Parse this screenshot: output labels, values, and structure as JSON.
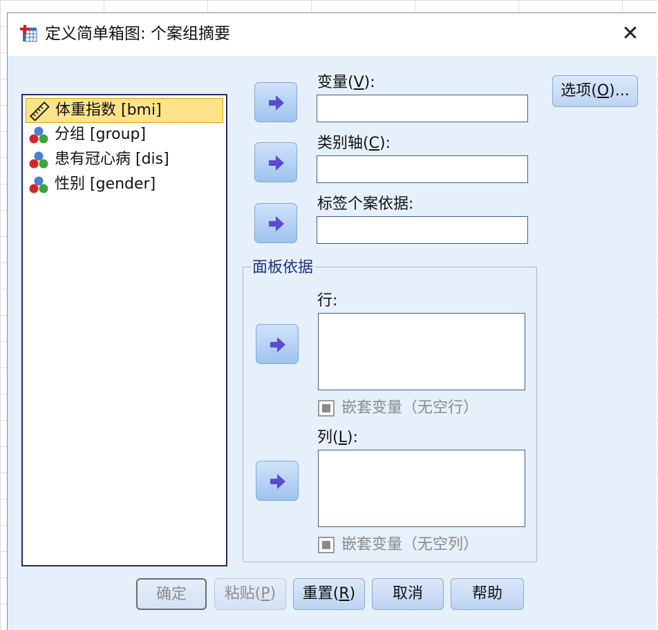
{
  "dialog": {
    "title": "定义简单箱图: 个案组摘要",
    "close_label": "✕"
  },
  "variables": [
    {
      "label": "体重指数 [bmi]",
      "icon": "ruler-scale-icon",
      "selected": true
    },
    {
      "label": "分组 [group]",
      "icon": "nominal-balls-icon",
      "selected": false
    },
    {
      "label": "患有冠心病 [dis]",
      "icon": "nominal-balls-icon",
      "selected": false
    },
    {
      "label": "性别 [gender]",
      "icon": "nominal-balls-icon",
      "selected": false
    }
  ],
  "fields": {
    "variable": {
      "label_pre": "变量(",
      "label_key": "V",
      "label_post": "):",
      "value": ""
    },
    "category_axis": {
      "label_pre": "类别轴(",
      "label_key": "C",
      "label_post": "):",
      "value": ""
    },
    "label_cases": {
      "label": "标签个案依据:",
      "value": ""
    }
  },
  "panel": {
    "legend": "面板依据",
    "rows": {
      "label": "行:",
      "nest_label": "嵌套变量（无空行）",
      "nest_checked": false,
      "nest_enabled": false
    },
    "columns": {
      "label_pre": "列(",
      "label_key": "L",
      "label_post": "):",
      "nest_label": "嵌套变量（无空列）",
      "nest_checked": false,
      "nest_enabled": false
    }
  },
  "options_button": {
    "label_pre": "选项(",
    "label_key": "O",
    "label_post": ")..."
  },
  "buttons": {
    "ok": "确定",
    "paste_pre": "粘贴(",
    "paste_key": "P",
    "paste_post": ")",
    "reset_pre": "重置(",
    "reset_key": "R",
    "reset_post": ")",
    "cancel": "取消",
    "help": "帮助"
  },
  "colors": {
    "dialog_bg": "#e6f0fb",
    "accent": "#2b5ea8",
    "selection": "#ffe38a",
    "arrow": "#5a4bd1"
  }
}
